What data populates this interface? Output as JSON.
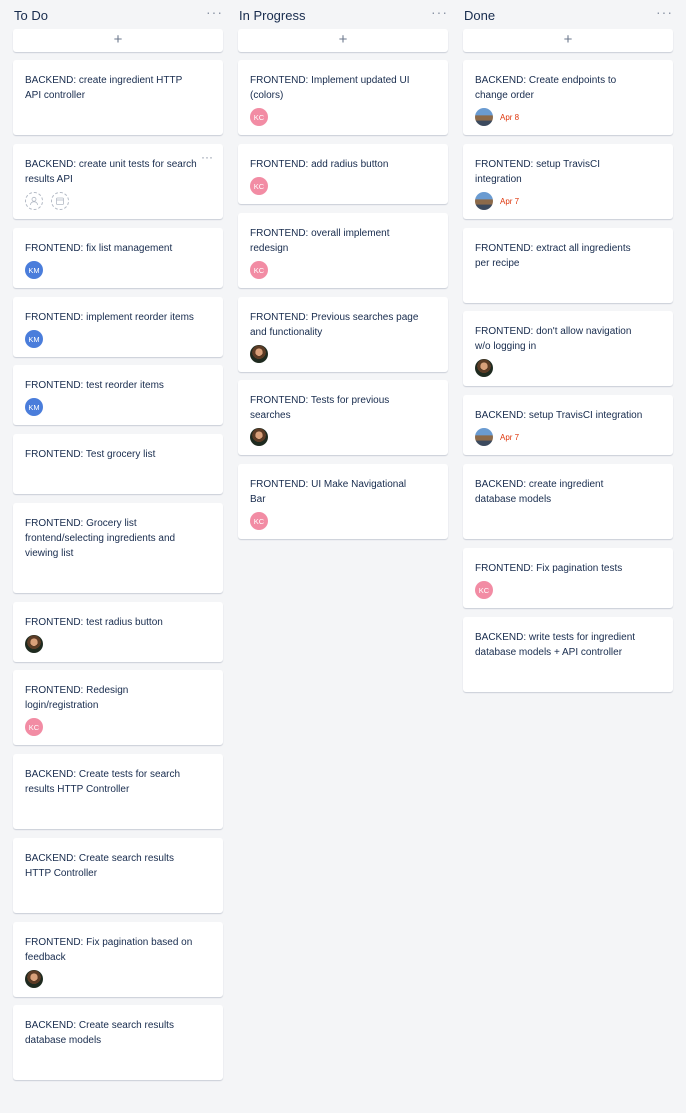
{
  "columns": [
    {
      "title": "To Do",
      "menu": "···",
      "add": "+",
      "cards": [
        {
          "title": "BACKEND: create ingredient HTTP API controller"
        },
        {
          "title": "BACKEND: create unit tests for search results API",
          "menu": "···"
        },
        {
          "title": "FRONTEND: fix list management",
          "avatar": "KM"
        },
        {
          "title": "FRONTEND: implement reorder items",
          "avatar": "KM"
        },
        {
          "title": "FRONTEND: test reorder items",
          "avatar": "KM"
        },
        {
          "title": "FRONTEND: Test grocery list"
        },
        {
          "title": "FRONTEND: Grocery list frontend/selecting ingredients and viewing list"
        },
        {
          "title": "FRONTEND: test radius button"
        },
        {
          "title": "FRONTEND: Redesign login/registration",
          "avatar": "KC"
        },
        {
          "title": "BACKEND: Create tests for search results HTTP Controller"
        },
        {
          "title": "BACKEND: Create search results HTTP Controller"
        },
        {
          "title": "FRONTEND: Fix pagination based on feedback"
        },
        {
          "title": "BACKEND: Create search results database models"
        }
      ]
    },
    {
      "title": "In Progress",
      "menu": "···",
      "add": "+",
      "cards": [
        {
          "title": "FRONTEND: Implement updated UI (colors)",
          "avatar": "KC"
        },
        {
          "title": "FRONTEND: add radius button",
          "avatar": "KC"
        },
        {
          "title": "FRONTEND: overall implement redesign",
          "avatar": "KC"
        },
        {
          "title": "FRONTEND: Previous searches page and functionality"
        },
        {
          "title": "FRONTEND: Tests for previous searches"
        },
        {
          "title": "FRONTEND: UI Make Navigational Bar",
          "avatar": "KC"
        }
      ]
    },
    {
      "title": "Done",
      "menu": "···",
      "add": "+",
      "cards": [
        {
          "title": "BACKEND: Create endpoints to change order",
          "due": "Apr 8"
        },
        {
          "title": "FRONTEND: setup TravisCI integration",
          "due": "Apr 7"
        },
        {
          "title": "FRONTEND: extract all ingredients per recipe"
        },
        {
          "title": "FRONTEND: don't allow navigation w/o logging in"
        },
        {
          "title": "BACKEND: setup TravisCI integration",
          "due": "Apr 7"
        },
        {
          "title": "BACKEND: create ingredient database models"
        },
        {
          "title": "FRONTEND: Fix pagination tests",
          "avatar": "KC"
        },
        {
          "title": "BACKEND: write tests for ingredient database models + API controller"
        }
      ]
    }
  ]
}
